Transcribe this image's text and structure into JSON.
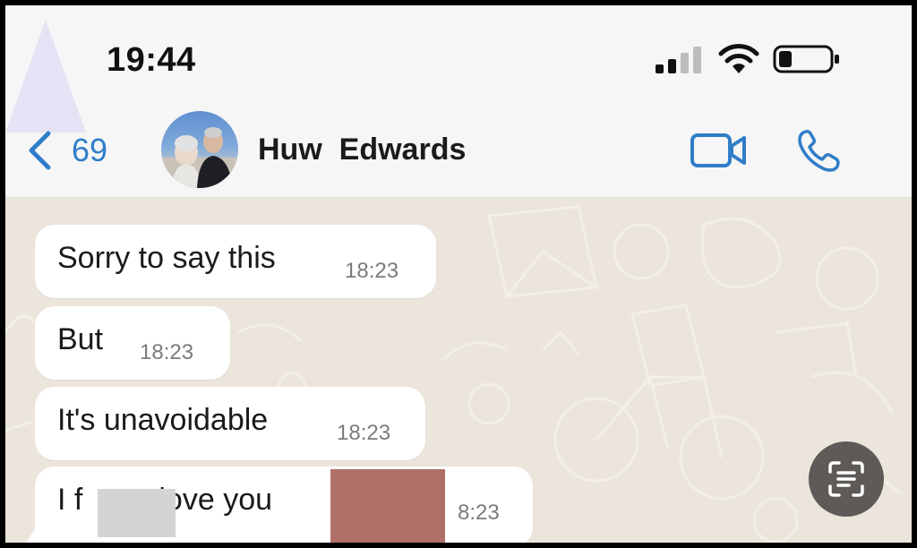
{
  "status_bar": {
    "time": "19:44",
    "signal_icon": "signal-bars-icon",
    "wifi_icon": "wifi-icon",
    "battery_icon": "battery-icon"
  },
  "header": {
    "back_count": "69",
    "back_icon": "chevron-left-icon",
    "contact_name": "Huw  Edwards",
    "video_icon": "video-call-icon",
    "call_icon": "phone-icon",
    "accent_color": "#2f7dc8"
  },
  "messages": [
    {
      "text": "Sorry to say this",
      "time": "18:23"
    },
    {
      "text": "But",
      "time": "18:23"
    },
    {
      "text": "It's unavoidable",
      "time": "18:23"
    },
    {
      "text": "I f      g love you",
      "time": "8:23"
    }
  ],
  "scan_button": {
    "icon": "text-scan-icon"
  }
}
